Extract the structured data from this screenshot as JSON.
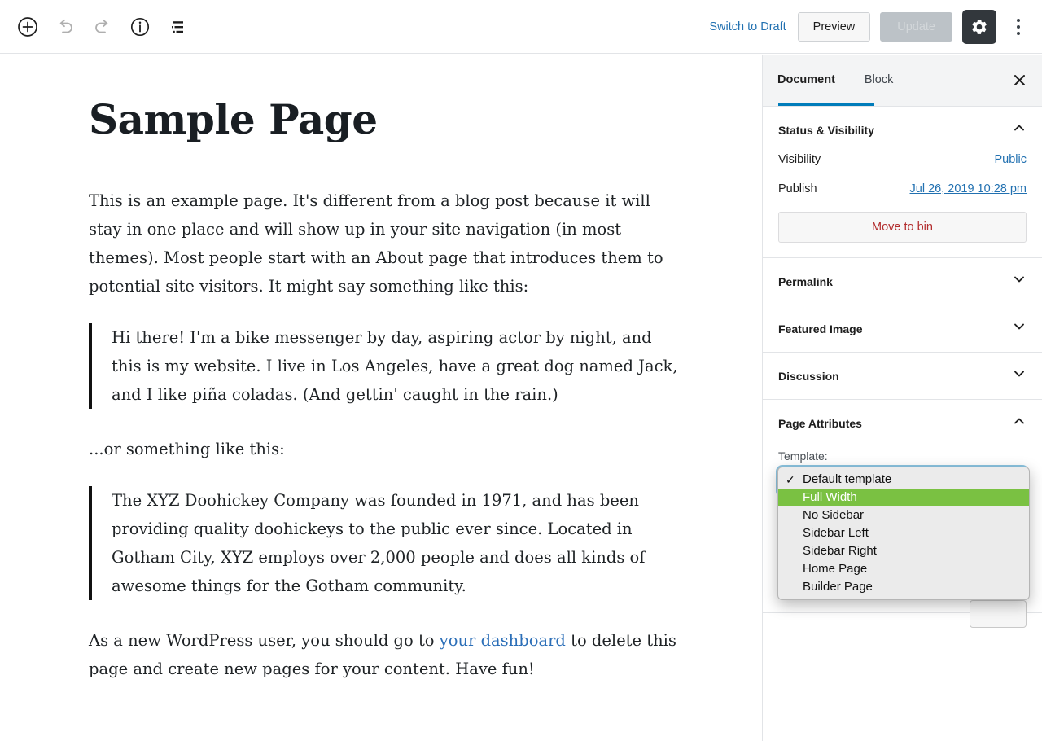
{
  "toolbar": {
    "add_block_label": "Add block",
    "undo_label": "Undo",
    "redo_label": "Redo",
    "info_label": "Content structure",
    "list_view_label": "Block navigation",
    "switch_to_draft": "Switch to Draft",
    "preview": "Preview",
    "update": "Update",
    "settings_label": "Settings",
    "more_label": "More tools & options"
  },
  "editor": {
    "title": "Sample Page",
    "paragraph_1": "This is an example page. It's different from a blog post because it will stay in one place and will show up in your site navigation (in most themes). Most people start with an About page that introduces them to potential site visitors. It might say something like this:",
    "quote_1": "Hi there! I'm a bike messenger by day, aspiring actor by night, and this is my website. I live in Los Angeles, have a great dog named Jack, and I like piña coladas. (And gettin' caught in the rain.)",
    "paragraph_2": "...or something like this:",
    "quote_2": "The XYZ Doohickey Company was founded in 1971, and has been providing quality doohickeys to the public ever since. Located in Gotham City, XYZ employs over 2,000 people and does all kinds of awesome things for the Gotham community.",
    "paragraph_3_before": "As a new WordPress user, you should go to ",
    "paragraph_3_link": "your dashboard",
    "paragraph_3_after": " to delete this page and create new pages for your content. Have fun!"
  },
  "sidebar": {
    "tab_document": "Document",
    "tab_block": "Block",
    "close_label": "Close settings",
    "status_panel": {
      "title": "Status & Visibility",
      "visibility_label": "Visibility",
      "visibility_value": "Public",
      "publish_label": "Publish",
      "publish_value": "Jul 26, 2019 10:28 pm",
      "trash_label": "Move to bin"
    },
    "permalink_panel": {
      "title": "Permalink"
    },
    "featured_image_panel": {
      "title": "Featured Image"
    },
    "discussion_panel": {
      "title": "Discussion"
    },
    "page_attributes_panel": {
      "title": "Page Attributes",
      "template_label": "Template:",
      "template_selected": "Default template",
      "template_options": [
        "Default template",
        "Full Width",
        "No Sidebar",
        "Sidebar Left",
        "Sidebar Right",
        "Home Page",
        "Builder Page"
      ],
      "template_highlighted": "Full Width"
    }
  },
  "colors": {
    "accent_blue": "#007cba",
    "link_blue": "#2271b1",
    "danger_red": "#b32d2e",
    "highlight_green": "#7ac142",
    "dark_button": "#32373c"
  }
}
